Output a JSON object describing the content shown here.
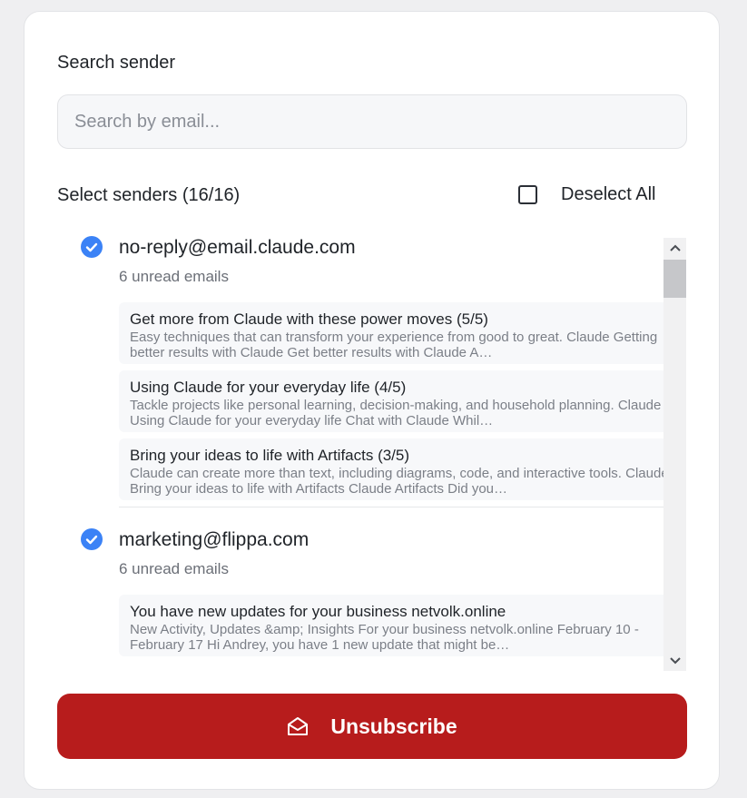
{
  "search": {
    "label": "Search sender",
    "placeholder": "Search by email...",
    "value": ""
  },
  "selection": {
    "label": "Select senders (16/16)",
    "deselect_label": "Deselect All"
  },
  "senders": [
    {
      "email": "no-reply@email.claude.com",
      "count": "6 unread emails",
      "checked": true,
      "emails": [
        {
          "subject": "Get more from Claude with these power moves (5/5)",
          "preview": "Easy techniques that can transform your experience from good to great. Claude Getting better results with Claude Get better results with Claude A…"
        },
        {
          "subject": "Using Claude for your everyday life (4/5)",
          "preview": "Tackle projects like personal learning, decision-making, and household planning. Claude Using Claude for your everyday life Chat with Claude Whil…"
        },
        {
          "subject": "Bring your ideas to life with Artifacts (3/5)",
          "preview": "Claude can create more than text, including diagrams, code, and interactive tools. Claude Bring your ideas to life with Artifacts Claude Artifacts Did you…"
        }
      ]
    },
    {
      "email": "marketing@flippa.com",
      "count": "6 unread emails",
      "checked": true,
      "emails": [
        {
          "subject": "You have new updates for your business netvolk.online",
          "preview": "New Activity, Updates &amp; Insights For your business netvolk.online February 10 - February 17 Hi Andrey, you have 1 new update that might be…"
        }
      ]
    }
  ],
  "unsubscribe": {
    "label": "Unsubscribe"
  },
  "colors": {
    "accent": "#b71c1c",
    "check": "#3b82f6"
  },
  "icons": {
    "check": "check-circle-icon",
    "unsubscribe": "envelope-open-icon"
  }
}
